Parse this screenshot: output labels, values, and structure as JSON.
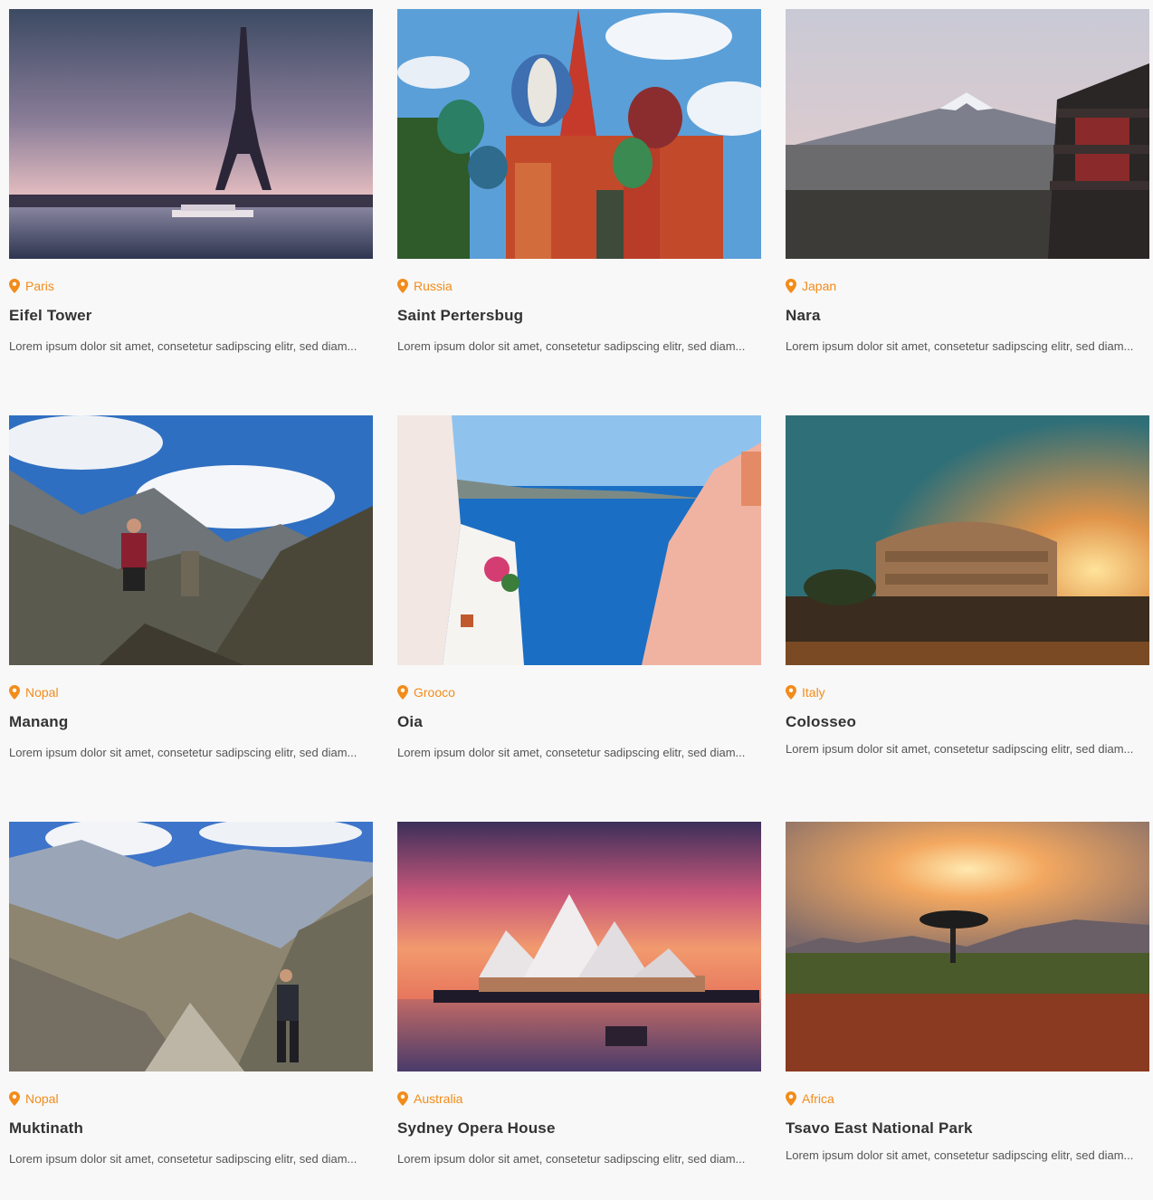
{
  "cards": [
    {
      "location": "Paris",
      "title": "Eifel Tower",
      "description": "Lorem ipsum dolor sit amet, consetetur sadipscing elitr, sed diam..."
    },
    {
      "location": "Russia",
      "title": "Saint Pertersbug",
      "description": "Lorem ipsum dolor sit amet, consetetur sadipscing elitr, sed diam..."
    },
    {
      "location": "Japan",
      "title": "Nara",
      "description": "Lorem ipsum dolor sit amet, consetetur sadipscing elitr, sed diam..."
    },
    {
      "location": "Nopal",
      "title": "Manang",
      "description": "Lorem ipsum dolor sit amet, consetetur sadipscing elitr, sed diam..."
    },
    {
      "location": "Grooco",
      "title": "Oia",
      "description": "Lorem ipsum dolor sit amet, consetetur sadipscing elitr, sed diam..."
    },
    {
      "location": "Italy",
      "title": "Colosseo",
      "description": "Lorem ipsum dolor sit amet, consetetur sadipscing elitr, sed diam..."
    },
    {
      "location": "Nopal",
      "title": "Muktinath",
      "description": "Lorem ipsum dolor sit amet, consetetur sadipscing elitr, sed diam..."
    },
    {
      "location": "Australia",
      "title": "Sydney Opera House",
      "description": "Lorem ipsum dolor sit amet, consetetur sadipscing elitr, sed diam..."
    },
    {
      "location": "Africa",
      "title": "Tsavo East National Park",
      "description": "Lorem ipsum dolor sit amet, consetetur sadipscing elitr, sed diam..."
    }
  ],
  "icons": {
    "location": "map-pin-icon"
  },
  "colors": {
    "accent": "#f28c1b",
    "title": "#333333",
    "text": "#555555",
    "background": "#f8f8f8"
  }
}
